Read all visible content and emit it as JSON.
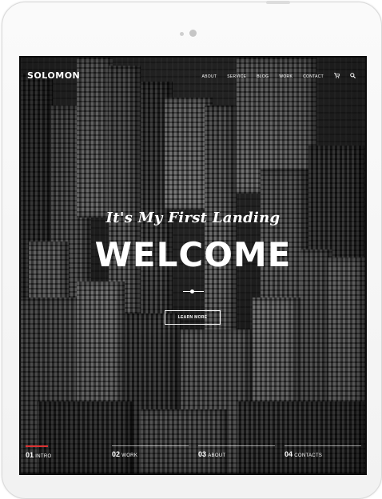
{
  "brand": {
    "name": "SOLOMON"
  },
  "nav": {
    "items": [
      {
        "label": "ABOUT"
      },
      {
        "label": "SERVICE"
      },
      {
        "label": "BLOG"
      },
      {
        "label": "WORK"
      },
      {
        "label": "CONTACT"
      }
    ],
    "cart_icon": "cart-icon",
    "search_icon": "search-icon"
  },
  "hero": {
    "tagline": "It's My First Landing",
    "headline": "WELCOME",
    "cta_label": "LEARN MORE"
  },
  "sections": [
    {
      "number": "01",
      "name": "INTRO"
    },
    {
      "number": "02",
      "name": "WORK"
    },
    {
      "number": "03",
      "name": "ABOUT"
    },
    {
      "number": "04",
      "name": "CONTACTS"
    }
  ],
  "colors": {
    "accent": "#d33333",
    "text": "#ffffff",
    "device_frame": "#f5f5f5"
  }
}
